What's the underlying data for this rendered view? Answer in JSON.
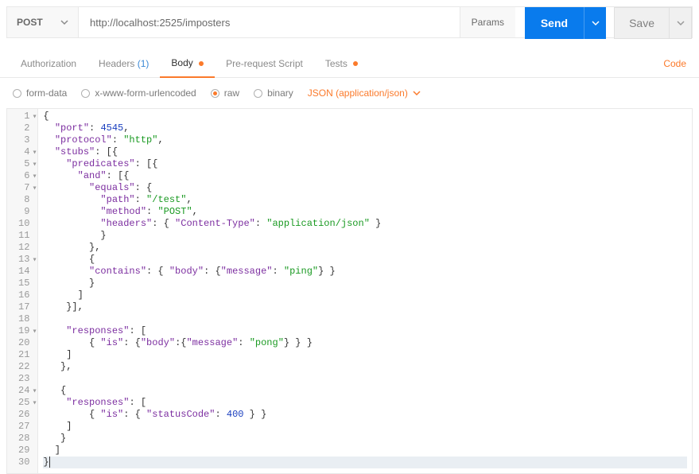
{
  "topbar": {
    "method": "POST",
    "url": "http://localhost:2525/imposters",
    "params_label": "Params",
    "send_label": "Send",
    "save_label": "Save"
  },
  "tabs": {
    "authorization": "Authorization",
    "headers": "Headers",
    "headers_count": "(1)",
    "body": "Body",
    "prerequest": "Pre-request Script",
    "tests": "Tests",
    "code_link": "Code"
  },
  "body_subtabs": {
    "form_data": "form-data",
    "urlencoded": "x-www-form-urlencoded",
    "raw": "raw",
    "binary": "binary",
    "content_type": "JSON (application/json)"
  },
  "editor": {
    "line_count": 30,
    "fold_lines": [
      1,
      4,
      5,
      6,
      7,
      13,
      19,
      24,
      25
    ],
    "selected_line": 30,
    "lines_html": [
      "<span class='p'>{</span>",
      "  <span class='k'>\"port\"</span>: <span class='n'>4545</span>,",
      "  <span class='k'>\"protocol\"</span>: <span class='s'>\"http\"</span>,",
      "  <span class='k'>\"stubs\"</span>: [{",
      "    <span class='k'>\"predicates\"</span>: [{",
      "      <span class='k'>\"and\"</span>: [{",
      "        <span class='k'>\"equals\"</span>: {",
      "          <span class='k'>\"path\"</span>: <span class='s'>\"/test\"</span>,",
      "          <span class='k'>\"method\"</span>: <span class='s'>\"POST\"</span>,",
      "          <span class='k'>\"headers\"</span>: { <span class='k'>\"Content-Type\"</span>: <span class='s'>\"application/json\"</span> }",
      "          }",
      "        },",
      "        {",
      "        <span class='k'>\"contains\"</span>: { <span class='k'>\"body\"</span>: {<span class='k'>\"message\"</span>: <span class='s'>\"ping\"</span>} }",
      "        }",
      "      ]",
      "    }],",
      "",
      "    <span class='k'>\"responses\"</span>: [",
      "        { <span class='k'>\"is\"</span>: {<span class='k'>\"body\"</span>:{<span class='k'>\"message\"</span>: <span class='s'>\"pong\"</span>} } }",
      "    ]",
      "   },",
      "",
      "   {",
      "    <span class='k'>\"responses\"</span>: [",
      "        { <span class='k'>\"is\"</span>: { <span class='k'>\"statusCode\"</span>: <span class='n'>400</span> } }",
      "    ]",
      "   }",
      "  ]",
      "}<span class='cursor'></span>"
    ]
  }
}
